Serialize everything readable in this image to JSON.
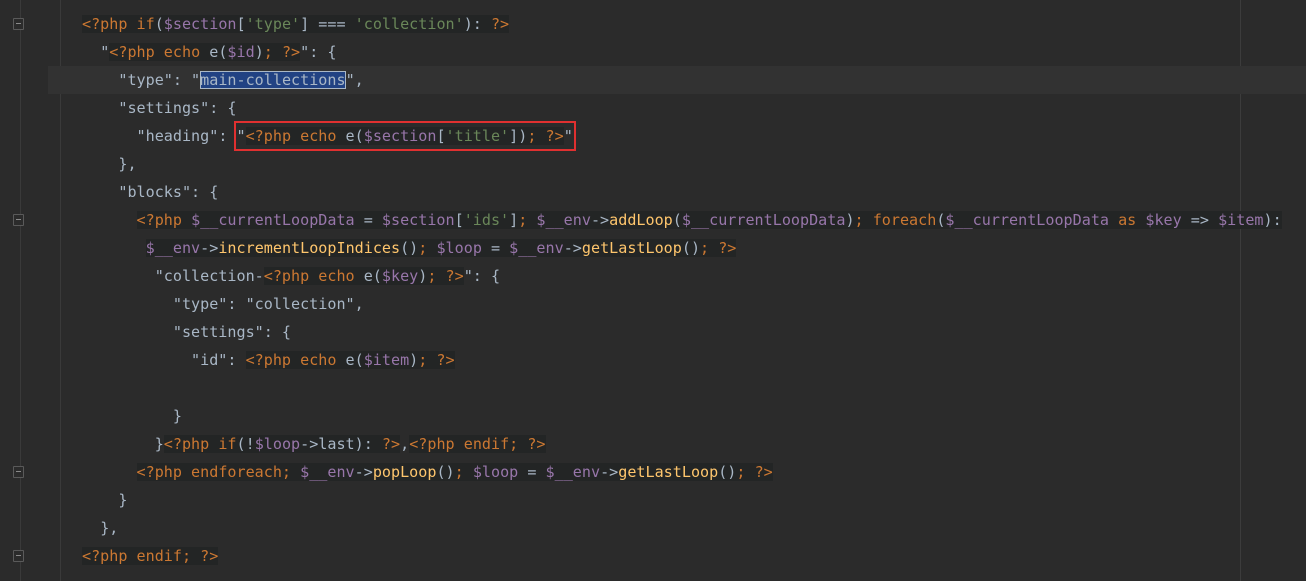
{
  "editor": {
    "language": "blade-php",
    "current_line": 3,
    "fold_lines": [
      1,
      8,
      17,
      20
    ],
    "colors": {
      "background": "#2b2b2b",
      "keyword": "#cc7832",
      "variable": "#9876aa",
      "string": "#6a8759",
      "default": "#a9b7c6",
      "method": "#ffc66d",
      "selection": "#214283",
      "highlight_box": "#e03030"
    },
    "lines": [
      {
        "indent": 0,
        "tokens": [
          [
            "kw",
            "<?php if",
            1
          ],
          [
            "def",
            "(",
            1
          ],
          [
            "var",
            "$section",
            1
          ],
          [
            "def",
            "[",
            1
          ],
          [
            "str",
            "'type'",
            1
          ],
          [
            "def",
            "] === ",
            1
          ],
          [
            "str",
            "'collection'",
            1
          ],
          [
            "def",
            "): ",
            1
          ],
          [
            "kw",
            "?>",
            1
          ]
        ]
      },
      {
        "indent": 2,
        "tokens": [
          [
            "def",
            "\"",
            0
          ],
          [
            "kw",
            "<?php echo",
            1
          ],
          [
            "def",
            " e(",
            1
          ],
          [
            "var",
            "$id",
            1
          ],
          [
            "def",
            ")",
            1
          ],
          [
            "kw",
            "; ?>",
            1
          ],
          [
            "def",
            "\": {",
            0
          ]
        ]
      },
      {
        "indent": 4,
        "tokens": [
          [
            "def",
            "\"type\": \"",
            0
          ],
          [
            "sel",
            "main-collections",
            0
          ],
          [
            "def",
            "\",",
            0
          ]
        ]
      },
      {
        "indent": 4,
        "tokens": [
          [
            "def",
            "\"settings\": {",
            0
          ]
        ]
      },
      {
        "indent": 6,
        "tokens": [
          [
            "def",
            "\"heading\": ",
            0
          ],
          [
            "boxstart",
            "",
            0
          ],
          [
            "def",
            "\"",
            0
          ],
          [
            "kw",
            "<?php echo",
            1
          ],
          [
            "def",
            " e(",
            1
          ],
          [
            "var",
            "$section",
            1
          ],
          [
            "def",
            "[",
            1
          ],
          [
            "str",
            "'title'",
            1
          ],
          [
            "def",
            "])",
            1
          ],
          [
            "kw",
            "; ?>",
            1
          ],
          [
            "def",
            "\"",
            0
          ],
          [
            "boxend",
            "",
            0
          ]
        ]
      },
      {
        "indent": 4,
        "tokens": [
          [
            "def",
            "},",
            0
          ]
        ]
      },
      {
        "indent": 4,
        "tokens": [
          [
            "def",
            "\"blocks\": {",
            0
          ]
        ]
      },
      {
        "indent": 6,
        "tokens": [
          [
            "kw",
            "<?php ",
            1
          ],
          [
            "var",
            "$__currentLoopData",
            1
          ],
          [
            "def",
            " = ",
            1
          ],
          [
            "var",
            "$section",
            1
          ],
          [
            "def",
            "[",
            1
          ],
          [
            "str",
            "'ids'",
            1
          ],
          [
            "def",
            "]",
            1
          ],
          [
            "kw",
            "; ",
            1
          ],
          [
            "var",
            "$__env",
            1
          ],
          [
            "def",
            "->",
            1
          ],
          [
            "fn",
            "addLoop",
            1
          ],
          [
            "def",
            "(",
            1
          ],
          [
            "var",
            "$__currentLoopData",
            1
          ],
          [
            "def",
            ")",
            1
          ],
          [
            "kw",
            "; foreach",
            1
          ],
          [
            "def",
            "(",
            1
          ],
          [
            "var",
            "$__currentLoopData",
            1
          ],
          [
            "kw",
            " as ",
            1
          ],
          [
            "var",
            "$key",
            1
          ],
          [
            "def",
            " => ",
            1
          ],
          [
            "var",
            "$item",
            1
          ],
          [
            "def",
            "):",
            1
          ]
        ]
      },
      {
        "indent": 7,
        "tokens": [
          [
            "var",
            "$__env",
            1
          ],
          [
            "def",
            "->",
            1
          ],
          [
            "fn",
            "incrementLoopIndices",
            1
          ],
          [
            "def",
            "()",
            1
          ],
          [
            "kw",
            "; ",
            1
          ],
          [
            "var",
            "$loop",
            1
          ],
          [
            "def",
            " = ",
            1
          ],
          [
            "var",
            "$__env",
            1
          ],
          [
            "def",
            "->",
            1
          ],
          [
            "fn",
            "getLastLoop",
            1
          ],
          [
            "def",
            "()",
            1
          ],
          [
            "kw",
            "; ?>",
            1
          ]
        ]
      },
      {
        "indent": 8,
        "tokens": [
          [
            "def",
            "\"collection-",
            0
          ],
          [
            "kw",
            "<?php echo",
            1
          ],
          [
            "def",
            " e(",
            1
          ],
          [
            "var",
            "$key",
            1
          ],
          [
            "def",
            ")",
            1
          ],
          [
            "kw",
            "; ?>",
            1
          ],
          [
            "def",
            "\": {",
            0
          ]
        ]
      },
      {
        "indent": 10,
        "tokens": [
          [
            "def",
            "\"type\": \"collection\",",
            0
          ]
        ]
      },
      {
        "indent": 10,
        "tokens": [
          [
            "def",
            "\"settings\": {",
            0
          ]
        ]
      },
      {
        "indent": 12,
        "tokens": [
          [
            "def",
            "\"id\": ",
            0
          ],
          [
            "kw",
            "<?php echo",
            1
          ],
          [
            "def",
            " e(",
            1
          ],
          [
            "var",
            "$item",
            1
          ],
          [
            "def",
            ")",
            1
          ],
          [
            "kw",
            "; ?>",
            1
          ]
        ]
      },
      {
        "indent": 0,
        "tokens": []
      },
      {
        "indent": 10,
        "tokens": [
          [
            "def",
            "}",
            0
          ]
        ]
      },
      {
        "indent": 8,
        "tokens": [
          [
            "def",
            "}",
            0
          ],
          [
            "kw",
            "<?php if",
            1
          ],
          [
            "def",
            "(!",
            1
          ],
          [
            "var",
            "$loop",
            1
          ],
          [
            "def",
            "->last): ",
            1
          ],
          [
            "kw",
            "?>",
            1
          ],
          [
            "def",
            ",",
            0
          ],
          [
            "kw",
            "<?php endif; ?>",
            1
          ]
        ]
      },
      {
        "indent": 6,
        "tokens": [
          [
            "kw",
            "<?php endforeach; ",
            1
          ],
          [
            "var",
            "$__env",
            1
          ],
          [
            "def",
            "->",
            1
          ],
          [
            "fn",
            "popLoop",
            1
          ],
          [
            "def",
            "()",
            1
          ],
          [
            "kw",
            "; ",
            1
          ],
          [
            "var",
            "$loop",
            1
          ],
          [
            "def",
            " = ",
            1
          ],
          [
            "var",
            "$__env",
            1
          ],
          [
            "def",
            "->",
            1
          ],
          [
            "fn",
            "getLastLoop",
            1
          ],
          [
            "def",
            "()",
            1
          ],
          [
            "kw",
            "; ?>",
            1
          ]
        ]
      },
      {
        "indent": 4,
        "tokens": [
          [
            "def",
            "}",
            0
          ]
        ]
      },
      {
        "indent": 2,
        "tokens": [
          [
            "def",
            "},",
            0
          ]
        ]
      },
      {
        "indent": 0,
        "tokens": [
          [
            "kw",
            "<?php endif; ?>",
            1
          ]
        ]
      }
    ]
  }
}
